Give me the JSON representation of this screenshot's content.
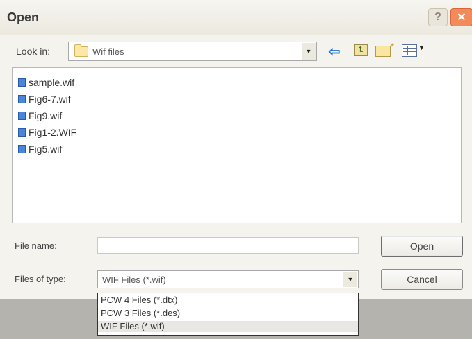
{
  "window": {
    "title": "Open",
    "help_label": "?",
    "close_label": "✕"
  },
  "toolbar": {
    "look_in_label": "Look in:",
    "look_in_value": "Wif files",
    "icons": [
      "folder-icon",
      "back-icon",
      "up-folder-icon",
      "new-folder-icon",
      "views-menu-icon"
    ]
  },
  "files": [
    {
      "name": "sample.wif",
      "icon": "wif-file-icon"
    },
    {
      "name": "Fig6-7.wif",
      "icon": "wif-file-icon"
    },
    {
      "name": "Fig9.wif",
      "icon": "wif-file-icon"
    },
    {
      "name": "Fig1-2.WIF",
      "icon": "wif-file-icon"
    },
    {
      "name": "Fig5.wif",
      "icon": "wif-file-icon"
    }
  ],
  "form": {
    "file_name_label": "File name:",
    "file_name_value": "",
    "files_of_type_label": "Files of type:",
    "files_of_type_value": "WIF Files (*.wif)",
    "type_options": [
      {
        "label": "PCW 4 Files (*.dtx)"
      },
      {
        "label": "PCW 3 Files (*.des)"
      },
      {
        "label": "WIF Files (*.wif)",
        "selected": true
      }
    ]
  },
  "buttons": {
    "open_label": "Open",
    "cancel_label": "Cancel"
  },
  "colors": {
    "close_button": "#f28a5a",
    "file_icon": "#4a86d8",
    "back_arrow": "#1f6fd1"
  }
}
